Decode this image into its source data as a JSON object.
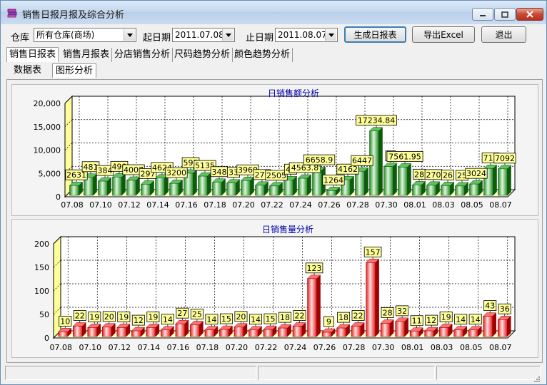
{
  "window": {
    "title": "销售日报月报及综合分析"
  },
  "toolbar": {
    "warehouse_label": "仓库",
    "warehouse_value": "所有仓库(商场)",
    "start_label": "起日期",
    "start_value": "2011.07.08",
    "end_label": "止日期",
    "end_value": "2011.08.07",
    "generate_button": "生成日报表",
    "export_button": "导出Excel",
    "exit_button": "退出"
  },
  "tabs": [
    "销售日报表",
    "销售月报表",
    "分店销售分析",
    "尺码趋势分析",
    "颜色趋势分析"
  ],
  "subtabs": [
    "数据表",
    "图形分析"
  ],
  "colors": {
    "amount_bar": "#1a8a1a",
    "quantity_bar": "#e81818",
    "label_bg": "#ffff99",
    "title": "#0000aa"
  },
  "chart_data": [
    {
      "type": "bar",
      "title": "日销售额分析",
      "categories": [
        "07.08",
        "07.09",
        "07.10",
        "07.11",
        "07.12",
        "07.13",
        "07.14",
        "07.15",
        "07.16",
        "07.17",
        "07.18",
        "07.19",
        "07.20",
        "07.21",
        "07.22",
        "07.23",
        "07.24",
        "07.25",
        "07.26",
        "07.27",
        "07.28",
        "07.29",
        "07.30",
        "07.31",
        "08.01",
        "08.02",
        "08.03",
        "08.04",
        "08.05",
        "08.06",
        "08.07"
      ],
      "tick_labels": [
        "07.08",
        "07.10",
        "07.12",
        "07.14",
        "07.16",
        "07.18",
        "07.20",
        "07.22",
        "07.24",
        "07.26",
        "07.28",
        "07.30",
        "08.01",
        "08.03",
        "08.05",
        "08.07"
      ],
      "values": [
        2631,
        4812,
        3800,
        4900,
        4007,
        2970,
        4620,
        3200,
        5920,
        5135,
        3480,
        3300,
        3960,
        2700,
        2505,
        4150,
        4563.8,
        6658.9,
        1264,
        4162,
        6447,
        17234.84,
        7700,
        7561.95,
        2800,
        2700,
        2600,
        2500,
        3024,
        7180,
        7092
      ],
      "data_labels": [
        "2631",
        "481",
        "384",
        "490",
        "4007",
        "297",
        "4624",
        "3200",
        "592",
        "5135",
        "348",
        "33",
        "3960",
        "277",
        "2505",
        "41",
        "4563.8",
        "6658.9",
        "1264",
        "4162",
        "6447",
        "17234.84",
        "7",
        "7561.95",
        "28",
        "270",
        "26",
        "25",
        "3024",
        "718",
        "7092"
      ],
      "yticks": [
        "0",
        "5,000",
        "10,000",
        "15,000",
        "20,000"
      ],
      "ylim": [
        0,
        25000
      ]
    },
    {
      "type": "bar",
      "title": "日销售量分析",
      "categories": [
        "07.08",
        "07.09",
        "07.10",
        "07.11",
        "07.12",
        "07.13",
        "07.14",
        "07.15",
        "07.16",
        "07.17",
        "07.18",
        "07.19",
        "07.20",
        "07.21",
        "07.22",
        "07.23",
        "07.24",
        "07.25",
        "07.26",
        "07.27",
        "07.28",
        "07.29",
        "07.30",
        "07.31",
        "08.01",
        "08.02",
        "08.03",
        "08.04",
        "08.05",
        "08.06",
        "08.07"
      ],
      "tick_labels": [
        "07.08",
        "07.10",
        "07.12",
        "07.14",
        "07.16",
        "07.18",
        "07.20",
        "07.22",
        "07.24",
        "07.26",
        "07.28",
        "07.30",
        "08.01",
        "08.03",
        "08.05",
        "08.07"
      ],
      "values": [
        10,
        22,
        19,
        20,
        19,
        12,
        19,
        14,
        27,
        25,
        14,
        15,
        20,
        14,
        15,
        18,
        22,
        123,
        9,
        18,
        22,
        157,
        28,
        32,
        11,
        12,
        19,
        14,
        14,
        43,
        36
      ],
      "data_labels": [
        "10",
        "22",
        "19",
        "20",
        "19",
        "12",
        "19",
        "14",
        "27",
        "25",
        "14",
        "15",
        "20",
        "14",
        "15",
        "18",
        "22",
        "123",
        "9",
        "18",
        "22",
        "157",
        "28",
        "32",
        "11",
        "12",
        "19",
        "14",
        "14",
        "43",
        "36"
      ],
      "yticks": [
        "0",
        "50",
        "100",
        "150",
        "200"
      ],
      "ylim": [
        0,
        200
      ]
    }
  ],
  "statusbar": {
    "cells": [
      "",
      "",
      ""
    ]
  }
}
